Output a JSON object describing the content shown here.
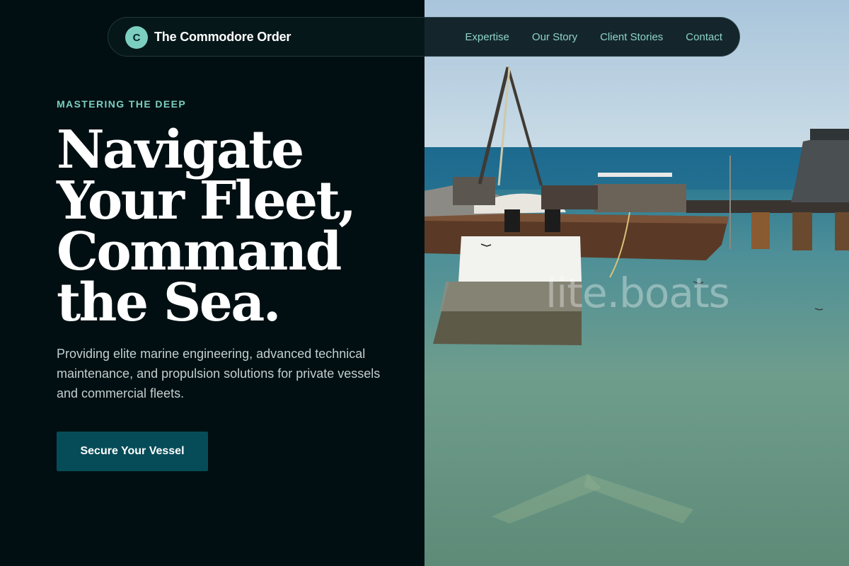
{
  "brand": {
    "logo_letter": "C",
    "name": "The Commodore Order"
  },
  "nav": {
    "links": [
      "Expertise",
      "Our Story",
      "Client Stories",
      "Contact"
    ]
  },
  "hero": {
    "eyebrow": "MASTERING THE DEEP",
    "headline_lines": [
      "Navigate",
      "Your Fleet,",
      "Command",
      "the Sea."
    ],
    "subtitle": "Providing elite marine engineering, advanced technical maintenance, and propulsion solutions for private vessels and commercial fleets.",
    "cta_label": "Secure Your Vessel"
  },
  "photo": {
    "watermark": "lite.boats"
  },
  "colors": {
    "background": "#010f12",
    "accent": "#7ccfc0",
    "cta": "#064c58",
    "nav_link": "#8fd3c6"
  }
}
